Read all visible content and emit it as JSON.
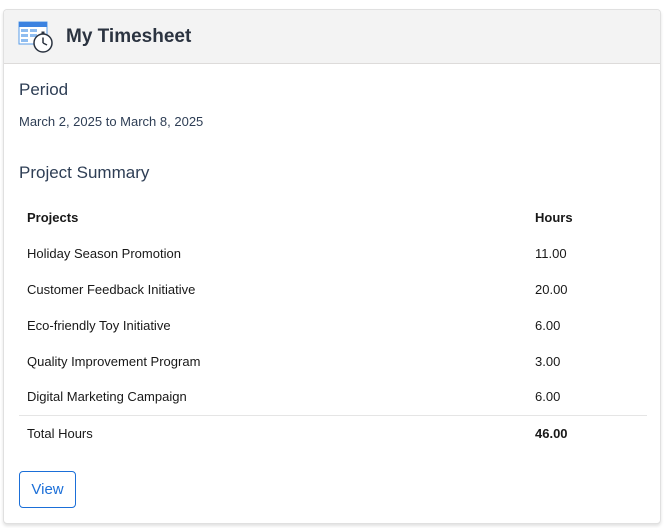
{
  "header": {
    "title": "My Timesheet",
    "icon": "timesheet-stopwatch-icon"
  },
  "period": {
    "title": "Period",
    "range": "March 2, 2025 to March 8, 2025"
  },
  "summary": {
    "title": "Project Summary",
    "columns": {
      "project": "Projects",
      "hours": "Hours"
    },
    "rows": [
      {
        "project": "Holiday Season Promotion",
        "hours": "11.00"
      },
      {
        "project": "Customer Feedback Initiative",
        "hours": "20.00"
      },
      {
        "project": "Eco-friendly Toy Initiative",
        "hours": "6.00"
      },
      {
        "project": "Quality Improvement Program",
        "hours": "3.00"
      },
      {
        "project": "Digital Marketing Campaign",
        "hours": "6.00"
      }
    ],
    "total": {
      "label": "Total Hours",
      "value": "46.00"
    }
  },
  "actions": {
    "view_label": "View"
  },
  "colors": {
    "accent": "#1b6fd8",
    "header_bg": "#f3f3f3",
    "section_text": "#2e3e55"
  }
}
